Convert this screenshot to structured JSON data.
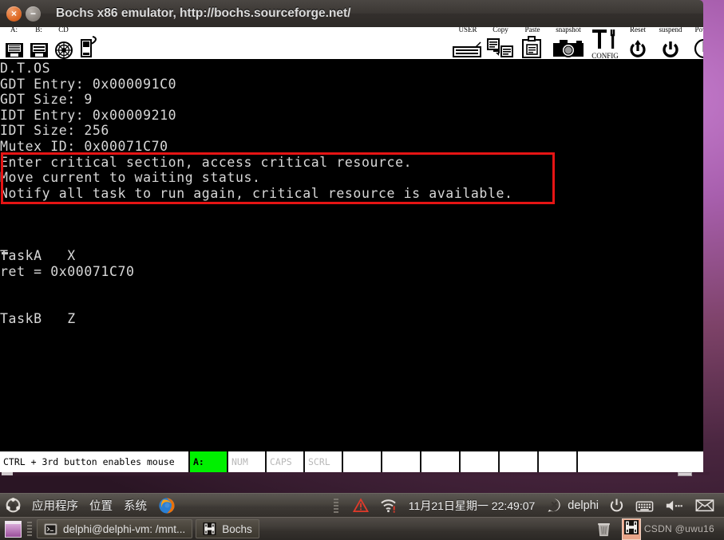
{
  "window": {
    "title": "Bochs x86 emulator, http://bochs.sourceforge.net/",
    "close_label": "×",
    "minimize_label": "−"
  },
  "toolbar": {
    "left_items": [
      {
        "name": "floppy-a-icon",
        "label": "A:"
      },
      {
        "name": "floppy-b-icon",
        "label": "B:"
      },
      {
        "name": "cdrom-icon",
        "label": "CD"
      },
      {
        "name": "usb-icon",
        "label": ""
      }
    ],
    "right_items": [
      {
        "name": "user-button-icon",
        "label": "USER"
      },
      {
        "name": "copy-icon",
        "label": "Copy"
      },
      {
        "name": "paste-icon",
        "label": "Paste"
      },
      {
        "name": "snapshot-icon",
        "label": "snapshot"
      },
      {
        "name": "config-icon",
        "label": "CONFIG"
      },
      {
        "name": "reset-icon",
        "label": "Reset"
      },
      {
        "name": "suspend-icon",
        "label": "suspend"
      },
      {
        "name": "power-icon",
        "label": "Power"
      }
    ]
  },
  "terminal": {
    "lines": [
      "D.T.OS",
      "GDT Entry: 0x000091C0",
      "GDT Size: 9",
      "IDT Entry: 0x00009210",
      "IDT Size: 256",
      "Mutex ID: 0x00071C70",
      "Enter critical section, access critical resource.",
      "Move current to waiting status.",
      "Notify all task to run again, critical resource is available.",
      "",
      "",
      "",
      "TaskA   X",
      "ret = 0x00071C70",
      "",
      "",
      "TaskB   Z"
    ],
    "highlight_color": "#e61414",
    "text_color": "#d8d8d8",
    "background_color": "#000000"
  },
  "statusbar": {
    "message": "CTRL + 3rd button enables mouse",
    "indicators": [
      {
        "label": "A:",
        "state": "on"
      },
      {
        "label": "NUM",
        "state": "off"
      },
      {
        "label": "CAPS",
        "state": "off"
      },
      {
        "label": "SCRL",
        "state": "off"
      }
    ],
    "active_color": "#00f000",
    "blank_cells": 6
  },
  "gnome_panel": {
    "menus": [
      "应用程序",
      "位置",
      "系统"
    ],
    "firefox_icon": "firefox-icon",
    "warning_icon": "warning-triangle-icon",
    "network_icon": "wifi-icon",
    "clock": "11月21日星期一 22:49:07",
    "user_icon": "user-status-icon",
    "user": "delphi",
    "power_icon": "power-icon",
    "keyboard_icon": "keyboard-icon",
    "volume_icon": "volume-icon",
    "mail_icon": "mail-icon"
  },
  "taskbar": {
    "show_desktop_icon": "show-desktop-icon",
    "windows": [
      {
        "icon": "terminal-icon",
        "label": "delphi@delphi-vm: /mnt..."
      },
      {
        "icon": "bochs-icon",
        "label": "Bochs"
      }
    ],
    "trash_icon": "trash-icon",
    "workspace_icon": "workspace-bochs-icon",
    "watermark": "CSDN @uwu16"
  }
}
